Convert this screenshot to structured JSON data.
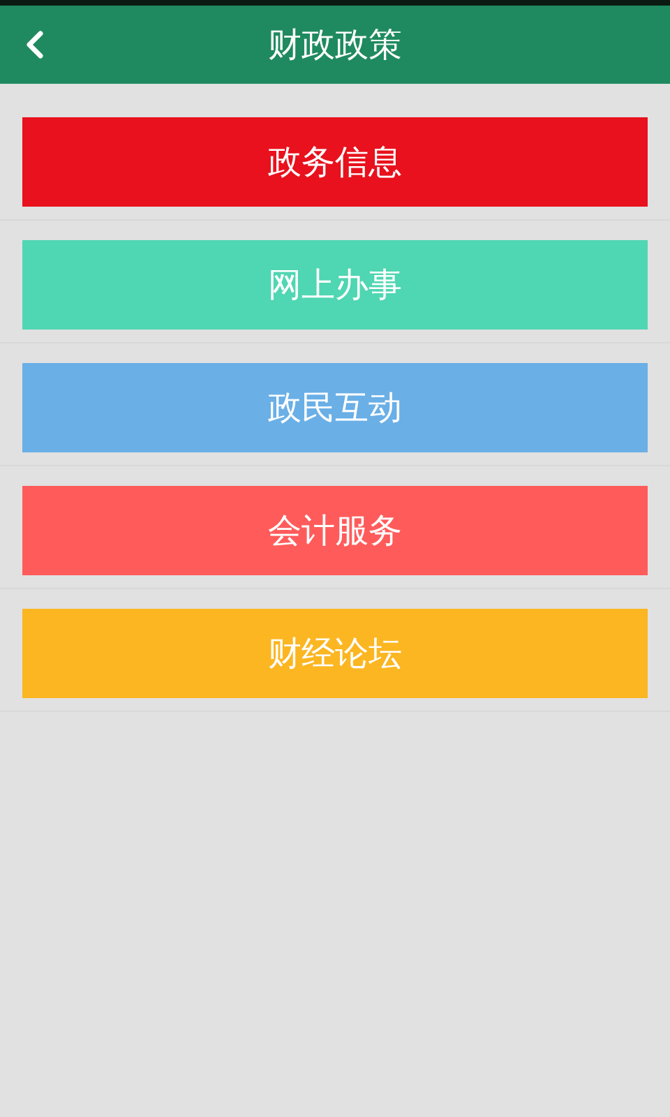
{
  "header": {
    "title": "财政政策"
  },
  "menu": [
    {
      "label": "政务信息",
      "color": "#e8111d"
    },
    {
      "label": "网上办事",
      "color": "#4fd6b2"
    },
    {
      "label": "政民互动",
      "color": "#6aafe6"
    },
    {
      "label": "会计服务",
      "color": "#ff5b5b"
    },
    {
      "label": "财经论坛",
      "color": "#fbb621"
    }
  ]
}
